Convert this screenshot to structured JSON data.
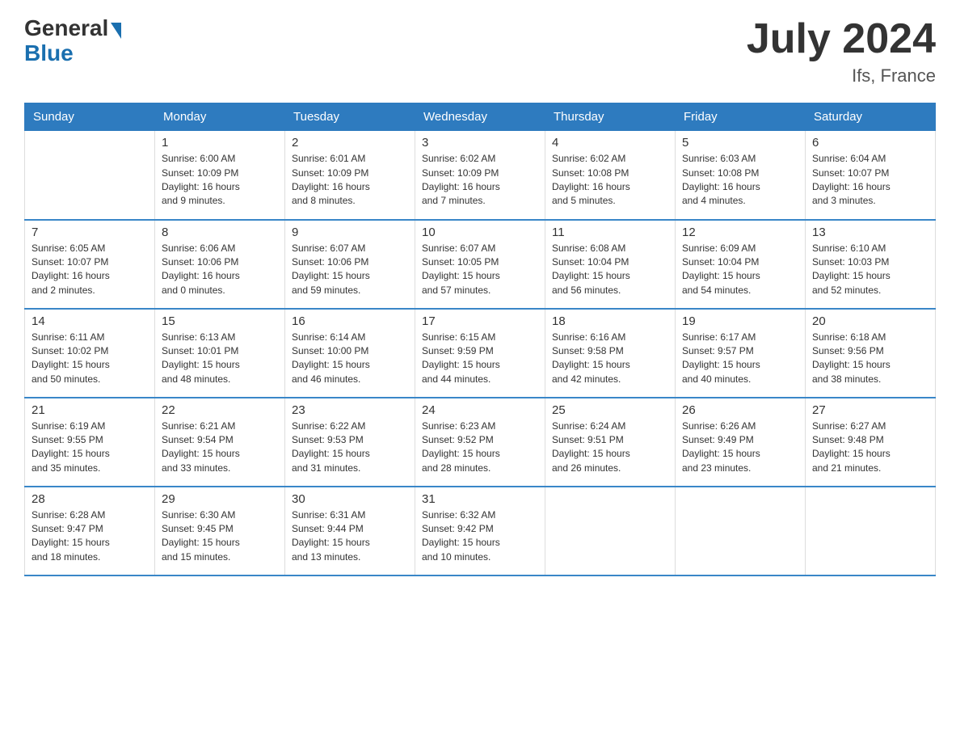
{
  "header": {
    "logo_general": "General",
    "logo_blue": "Blue",
    "title": "July 2024",
    "subtitle": "Ifs, France"
  },
  "weekdays": [
    "Sunday",
    "Monday",
    "Tuesday",
    "Wednesday",
    "Thursday",
    "Friday",
    "Saturday"
  ],
  "weeks": [
    [
      {
        "day": "",
        "info": ""
      },
      {
        "day": "1",
        "info": "Sunrise: 6:00 AM\nSunset: 10:09 PM\nDaylight: 16 hours\nand 9 minutes."
      },
      {
        "day": "2",
        "info": "Sunrise: 6:01 AM\nSunset: 10:09 PM\nDaylight: 16 hours\nand 8 minutes."
      },
      {
        "day": "3",
        "info": "Sunrise: 6:02 AM\nSunset: 10:09 PM\nDaylight: 16 hours\nand 7 minutes."
      },
      {
        "day": "4",
        "info": "Sunrise: 6:02 AM\nSunset: 10:08 PM\nDaylight: 16 hours\nand 5 minutes."
      },
      {
        "day": "5",
        "info": "Sunrise: 6:03 AM\nSunset: 10:08 PM\nDaylight: 16 hours\nand 4 minutes."
      },
      {
        "day": "6",
        "info": "Sunrise: 6:04 AM\nSunset: 10:07 PM\nDaylight: 16 hours\nand 3 minutes."
      }
    ],
    [
      {
        "day": "7",
        "info": "Sunrise: 6:05 AM\nSunset: 10:07 PM\nDaylight: 16 hours\nand 2 minutes."
      },
      {
        "day": "8",
        "info": "Sunrise: 6:06 AM\nSunset: 10:06 PM\nDaylight: 16 hours\nand 0 minutes."
      },
      {
        "day": "9",
        "info": "Sunrise: 6:07 AM\nSunset: 10:06 PM\nDaylight: 15 hours\nand 59 minutes."
      },
      {
        "day": "10",
        "info": "Sunrise: 6:07 AM\nSunset: 10:05 PM\nDaylight: 15 hours\nand 57 minutes."
      },
      {
        "day": "11",
        "info": "Sunrise: 6:08 AM\nSunset: 10:04 PM\nDaylight: 15 hours\nand 56 minutes."
      },
      {
        "day": "12",
        "info": "Sunrise: 6:09 AM\nSunset: 10:04 PM\nDaylight: 15 hours\nand 54 minutes."
      },
      {
        "day": "13",
        "info": "Sunrise: 6:10 AM\nSunset: 10:03 PM\nDaylight: 15 hours\nand 52 minutes."
      }
    ],
    [
      {
        "day": "14",
        "info": "Sunrise: 6:11 AM\nSunset: 10:02 PM\nDaylight: 15 hours\nand 50 minutes."
      },
      {
        "day": "15",
        "info": "Sunrise: 6:13 AM\nSunset: 10:01 PM\nDaylight: 15 hours\nand 48 minutes."
      },
      {
        "day": "16",
        "info": "Sunrise: 6:14 AM\nSunset: 10:00 PM\nDaylight: 15 hours\nand 46 minutes."
      },
      {
        "day": "17",
        "info": "Sunrise: 6:15 AM\nSunset: 9:59 PM\nDaylight: 15 hours\nand 44 minutes."
      },
      {
        "day": "18",
        "info": "Sunrise: 6:16 AM\nSunset: 9:58 PM\nDaylight: 15 hours\nand 42 minutes."
      },
      {
        "day": "19",
        "info": "Sunrise: 6:17 AM\nSunset: 9:57 PM\nDaylight: 15 hours\nand 40 minutes."
      },
      {
        "day": "20",
        "info": "Sunrise: 6:18 AM\nSunset: 9:56 PM\nDaylight: 15 hours\nand 38 minutes."
      }
    ],
    [
      {
        "day": "21",
        "info": "Sunrise: 6:19 AM\nSunset: 9:55 PM\nDaylight: 15 hours\nand 35 minutes."
      },
      {
        "day": "22",
        "info": "Sunrise: 6:21 AM\nSunset: 9:54 PM\nDaylight: 15 hours\nand 33 minutes."
      },
      {
        "day": "23",
        "info": "Sunrise: 6:22 AM\nSunset: 9:53 PM\nDaylight: 15 hours\nand 31 minutes."
      },
      {
        "day": "24",
        "info": "Sunrise: 6:23 AM\nSunset: 9:52 PM\nDaylight: 15 hours\nand 28 minutes."
      },
      {
        "day": "25",
        "info": "Sunrise: 6:24 AM\nSunset: 9:51 PM\nDaylight: 15 hours\nand 26 minutes."
      },
      {
        "day": "26",
        "info": "Sunrise: 6:26 AM\nSunset: 9:49 PM\nDaylight: 15 hours\nand 23 minutes."
      },
      {
        "day": "27",
        "info": "Sunrise: 6:27 AM\nSunset: 9:48 PM\nDaylight: 15 hours\nand 21 minutes."
      }
    ],
    [
      {
        "day": "28",
        "info": "Sunrise: 6:28 AM\nSunset: 9:47 PM\nDaylight: 15 hours\nand 18 minutes."
      },
      {
        "day": "29",
        "info": "Sunrise: 6:30 AM\nSunset: 9:45 PM\nDaylight: 15 hours\nand 15 minutes."
      },
      {
        "day": "30",
        "info": "Sunrise: 6:31 AM\nSunset: 9:44 PM\nDaylight: 15 hours\nand 13 minutes."
      },
      {
        "day": "31",
        "info": "Sunrise: 6:32 AM\nSunset: 9:42 PM\nDaylight: 15 hours\nand 10 minutes."
      },
      {
        "day": "",
        "info": ""
      },
      {
        "day": "",
        "info": ""
      },
      {
        "day": "",
        "info": ""
      }
    ]
  ]
}
